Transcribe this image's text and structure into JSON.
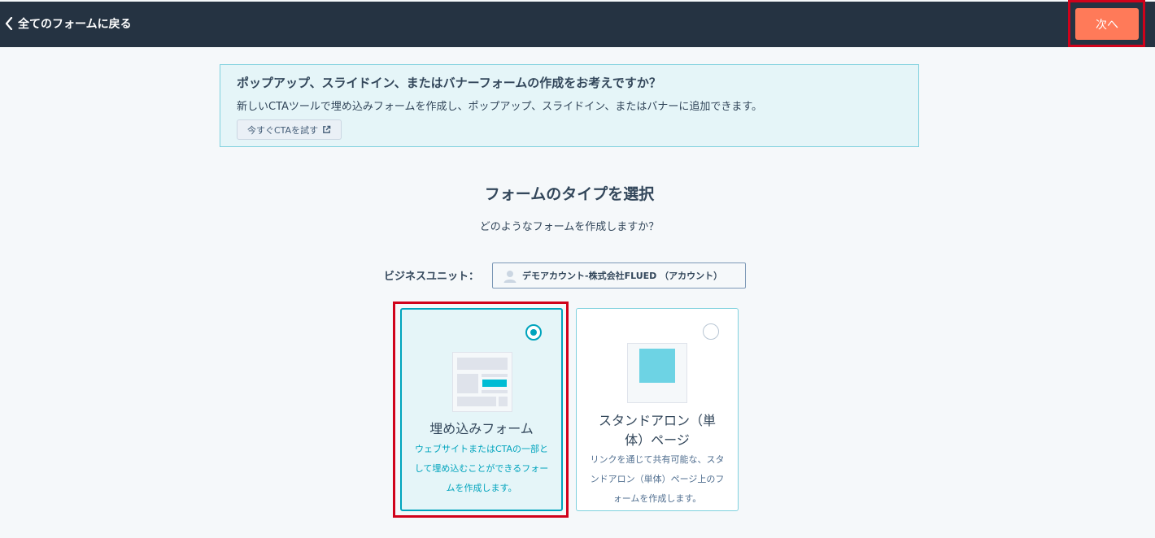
{
  "topbar": {
    "back_label": "全てのフォームに戻る",
    "next_label": "次へ",
    "bg_color": "#253342",
    "accent_color": "#ff7a59"
  },
  "banner": {
    "title": "ポップアップ、スライドイン、またはバナーフォームの作成をお考えですか？",
    "text": "新しいCTAツールで埋め込みフォームを作成し、ポップアップ、スライドイン、またはバナーに追加できます。",
    "button_label": "今すぐCTAを試す",
    "button_icon": "external-link-icon"
  },
  "main": {
    "title": "フォームのタイプを選択",
    "subtitle": "どのようなフォームを作成しますか？"
  },
  "business_unit": {
    "label": "ビジネスユニット：",
    "value": "デモアカウント-株式会社FLUED （アカウント）",
    "icon": "user-avatar-icon"
  },
  "cards": [
    {
      "title": "埋め込みフォーム",
      "description": "ウェブサイトまたはCTAの一部として埋め込むことができるフォームを作成します。",
      "selected": true,
      "icon": "embedded-form-illustration"
    },
    {
      "title": "スタンドアロン（単体）ページ",
      "description": "リンクを通じて共有可能な、スタンドアロン（単体）ページ上のフォームを作成します。",
      "selected": false,
      "icon": "standalone-page-illustration"
    }
  ],
  "colors": {
    "selected_border": "#00a4bd",
    "highlight_red": "#d0021b"
  }
}
